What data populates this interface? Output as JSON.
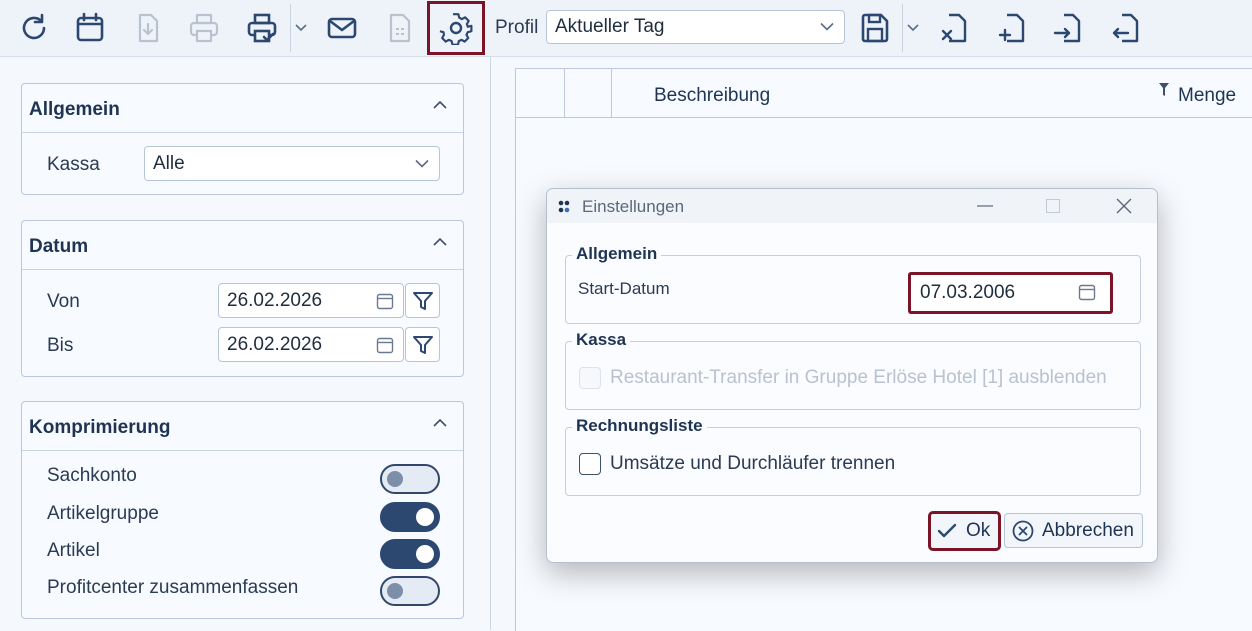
{
  "toolbar": {
    "buttons": [
      {
        "name": "refresh-icon"
      },
      {
        "name": "calendar-icon"
      },
      {
        "name": "download-icon"
      },
      {
        "name": "print-icon"
      },
      {
        "name": "print-preview-icon"
      },
      {
        "name": "mail-icon"
      },
      {
        "name": "document-icon"
      },
      {
        "name": "gear-icon"
      }
    ],
    "profil_label": "Profil",
    "profil_value": "Aktueller Tag",
    "right_icons": [
      "save-icon",
      "export-xls-icon",
      "add-document-icon",
      "import-icon",
      "export-icon"
    ]
  },
  "filters": {
    "allgemein": {
      "title": "Allgemein",
      "kassa_label": "Kassa",
      "kassa_value": "Alle"
    },
    "datum": {
      "title": "Datum",
      "von_label": "Von",
      "von_value": "26.02.2026",
      "bis_label": "Bis",
      "bis_value": "26.02.2026"
    },
    "komprimierung": {
      "title": "Komprimierung",
      "items": [
        {
          "label": "Sachkonto",
          "on": false
        },
        {
          "label": "Artikelgruppe",
          "on": true
        },
        {
          "label": "Artikel",
          "on": true
        },
        {
          "label": "Profitcenter zusammenfassen",
          "on": false
        }
      ]
    }
  },
  "grid": {
    "columns": [
      "",
      "",
      "Beschreibung",
      "Menge"
    ]
  },
  "dialog": {
    "title": "Einstellungen",
    "allgemein": {
      "legend": "Allgemein",
      "start_label": "Start-Datum",
      "start_value": "07.03.2006"
    },
    "kassa": {
      "legend": "Kassa",
      "checkbox_label": "Restaurant-Transfer in Gruppe Erlöse Hotel [1] ausblenden",
      "checked": false,
      "disabled": true
    },
    "rechnungsliste": {
      "legend": "Rechnungsliste",
      "checkbox_label": "Umsätze und Durchläufer trennen",
      "checked": false
    },
    "ok_label": "Ok",
    "cancel_label": "Abbrechen"
  },
  "colors": {
    "accent": "#2d4870",
    "highlight": "#7a1426",
    "disabled": "#b9c2cf"
  }
}
